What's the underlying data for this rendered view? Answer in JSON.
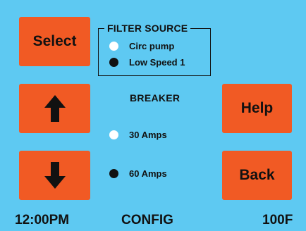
{
  "buttons": {
    "select": "Select",
    "help": "Help",
    "back": "Back",
    "up_icon": "arrow-up-icon",
    "down_icon": "arrow-down-icon"
  },
  "filter_source": {
    "title": "FILTER SOURCE",
    "options": [
      {
        "label": "Circ pump",
        "selected": false
      },
      {
        "label": "Low Speed 1",
        "selected": true
      }
    ]
  },
  "breaker": {
    "title": "BREAKER",
    "options": [
      {
        "label": "30 Amps",
        "selected": false
      },
      {
        "label": "60 Amps",
        "selected": true
      }
    ]
  },
  "status_bar": {
    "time": "12:00PM",
    "mode": "CONFIG",
    "temperature": "100F"
  },
  "colors": {
    "background": "#5ec9f2",
    "button": "#f15a24",
    "text": "#111111"
  }
}
